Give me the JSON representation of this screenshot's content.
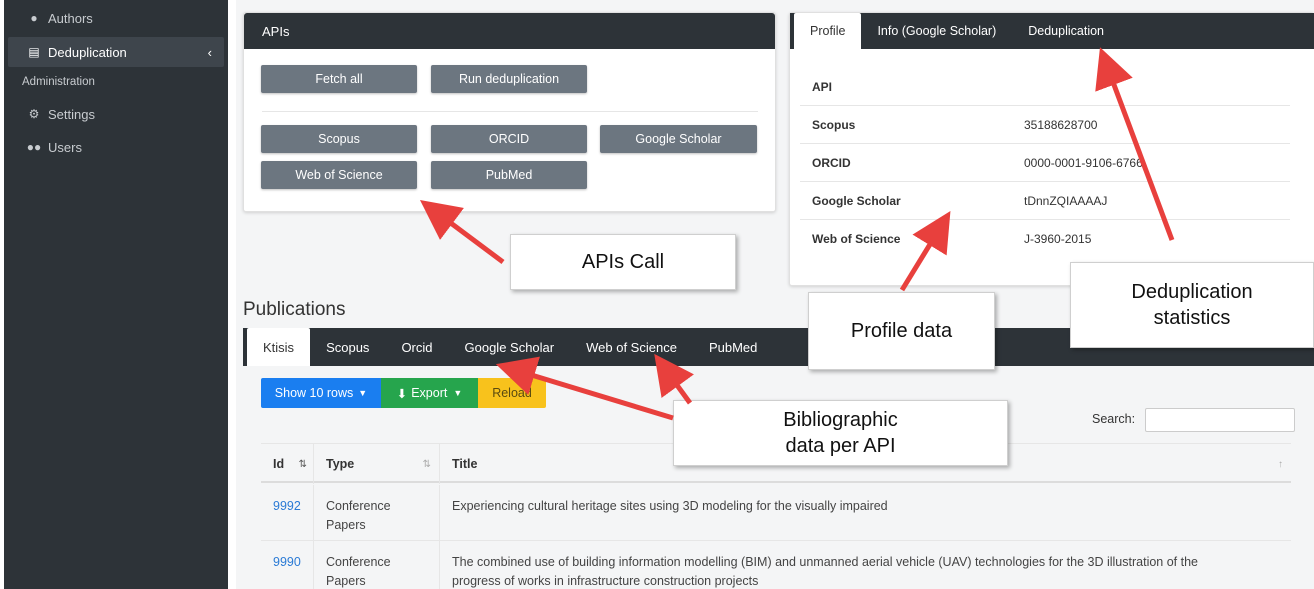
{
  "sidebar": {
    "items": [
      {
        "label": "Authors",
        "icon": "user-icon"
      },
      {
        "label": "Deduplication",
        "icon": "document-icon"
      },
      {
        "label": "Settings",
        "icon": "gears-icon"
      },
      {
        "label": "Users",
        "icon": "users-icon"
      }
    ],
    "section_header": "Administration"
  },
  "apis": {
    "title": "APIs",
    "actions": [
      "Fetch all",
      "Run deduplication"
    ],
    "sources": [
      "Scopus",
      "ORCID",
      "Google Scholar",
      "Web of Science",
      "PubMed"
    ]
  },
  "profile": {
    "tabs": [
      "Profile",
      "Info (Google Scholar)",
      "Deduplication"
    ],
    "rows": [
      {
        "key": "API",
        "value": ""
      },
      {
        "key": "Scopus",
        "value": "35188628700"
      },
      {
        "key": "ORCID",
        "value": "0000-0001-9106-6766"
      },
      {
        "key": "Google Scholar",
        "value": "tDnnZQIAAAAJ"
      },
      {
        "key": "Web of Science",
        "value": "J-3960-2015"
      }
    ]
  },
  "callouts": {
    "apis_call": "APIs Call",
    "profile_data": "Profile data",
    "dedup_line1": "Deduplication",
    "dedup_line2": "statistics",
    "biblio_line1": "Bibliographic",
    "biblio_line2": "data per API"
  },
  "publications": {
    "title": "Publications",
    "tabs": [
      "Ktisis",
      "Scopus",
      "Orcid",
      "Google Scholar",
      "Web of Science",
      "PubMed"
    ],
    "toolbar": {
      "show_rows": "Show 10 rows",
      "export": "Export",
      "reload": "Reload"
    },
    "search_label": "Search:",
    "columns": [
      "Id",
      "Type",
      "Title"
    ],
    "rows": [
      {
        "id": "9992",
        "type_line1": "Conference",
        "type_line2": "Papers",
        "title_line1": "Experiencing cultural heritage sites using 3D modeling for the visually impaired",
        "title_line2": ""
      },
      {
        "id": "9990",
        "type_line1": "Conference",
        "type_line2": "Papers",
        "title_line1": "The combined use of building information modelling (BIM) and unmanned aerial vehicle (UAV) technologies for the 3D illustration of the",
        "title_line2": "progress of works in infrastructure construction projects"
      }
    ]
  },
  "colors": {
    "dark": "#2d3338",
    "accent_arrow": "#e8403d",
    "blue": "#1a7ef0",
    "green": "#26a54d",
    "yellow": "#f8c21c"
  }
}
